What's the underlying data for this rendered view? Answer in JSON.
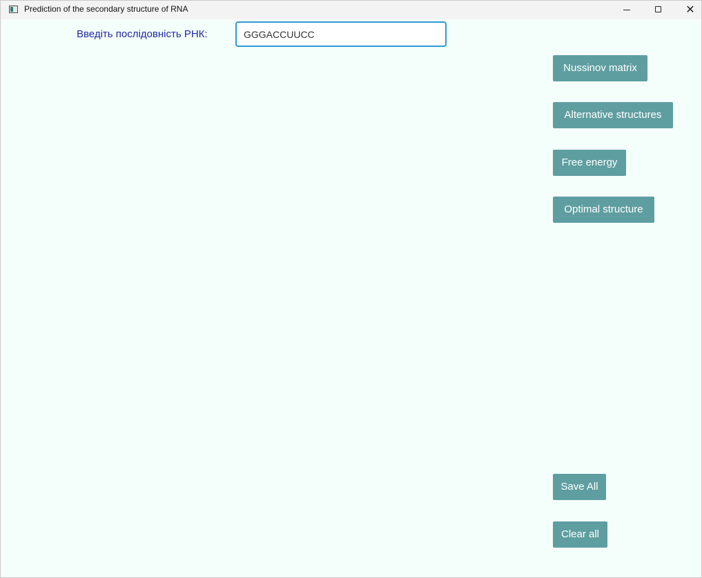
{
  "window": {
    "title": "Prediction of the secondary structure of RNA",
    "controls": {
      "minimize": "—",
      "maximize": "☐",
      "close": "✕"
    }
  },
  "form": {
    "sequence_label": "Введіть послідовність РНК:",
    "sequence_value": "GGGACCUUCC"
  },
  "buttons": {
    "nussinov": "Nussinov matrix",
    "alternative": "Alternative structures",
    "energy": "Free energy",
    "optimal": "Optimal structure",
    "save_all": "Save All",
    "clear_all": "Clear all"
  },
  "colors": {
    "background": "#f4fefa",
    "button": "#5f9ea0",
    "label": "#1f2aa0",
    "input_border": "#2d98d8"
  }
}
